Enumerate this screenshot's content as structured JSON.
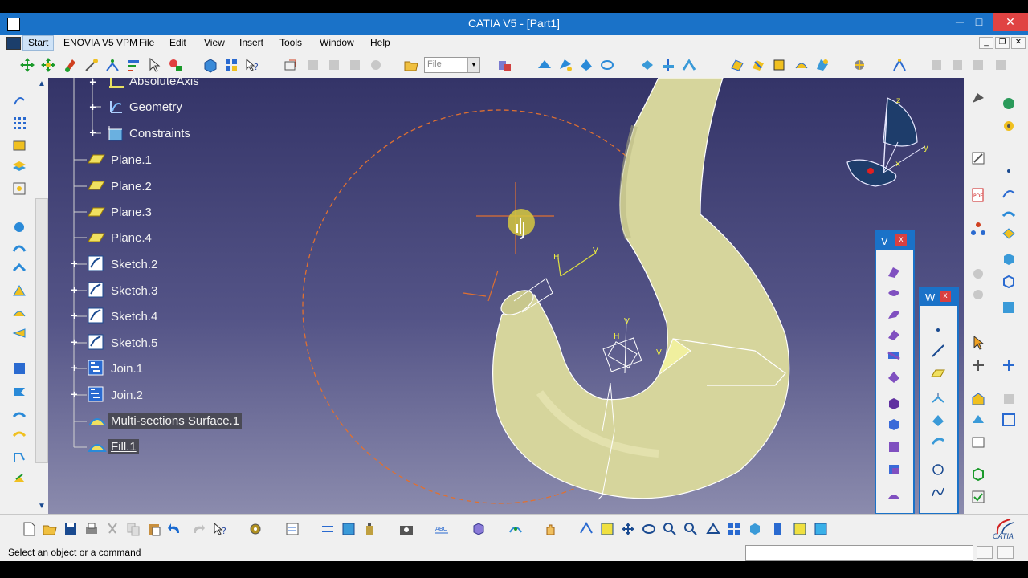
{
  "window": {
    "title": "CATIA V5 - [Part1]",
    "minimize": "─",
    "maximize": "□",
    "close": "✕"
  },
  "menubar": {
    "items": [
      "Start",
      "ENOVIA V5 VPM",
      "File",
      "Edit",
      "View",
      "Insert",
      "Tools",
      "Window",
      "Help"
    ]
  },
  "toolbar": {
    "file_select_value": "File"
  },
  "tree": {
    "nodes": [
      {
        "label": "AbsoluteAxis",
        "icon": "axis-system-icon"
      },
      {
        "label": "Geometry",
        "icon": "geometry-icon"
      },
      {
        "label": "Constraints",
        "icon": "constraints-icon"
      },
      {
        "label": "Plane.1",
        "icon": "plane-icon"
      },
      {
        "label": "Plane.2",
        "icon": "plane-icon"
      },
      {
        "label": "Plane.3",
        "icon": "plane-icon"
      },
      {
        "label": "Plane.4",
        "icon": "plane-icon"
      },
      {
        "label": "Sketch.2",
        "icon": "sketch-icon"
      },
      {
        "label": "Sketch.3",
        "icon": "sketch-icon"
      },
      {
        "label": "Sketch.4",
        "icon": "sketch-icon"
      },
      {
        "label": "Sketch.5",
        "icon": "sketch-icon"
      },
      {
        "label": "Join.1",
        "icon": "join-icon"
      },
      {
        "label": "Join.2",
        "icon": "join-icon"
      },
      {
        "label": "Multi-sections Surface.1",
        "icon": "multi-sections-surface-icon"
      },
      {
        "label": "Fill.1",
        "icon": "fill-icon"
      }
    ]
  },
  "compass": {
    "x": "x",
    "y": "y",
    "z": "z"
  },
  "viewport_labels": {
    "h1": "H",
    "v1": "V",
    "h2": "H",
    "v2": "V",
    "v3": "V"
  },
  "palettes": [
    {
      "title": "V",
      "close": "x"
    },
    {
      "title": "W",
      "close": "x"
    }
  ],
  "brand": {
    "logo_text": "CATIA"
  },
  "status": {
    "message": "Select an object or a command",
    "command_input": ""
  },
  "colors": {
    "titlebar": "#1a72c8",
    "viewport_top": "#343468",
    "viewport_bottom": "#8b8bad",
    "surface": "#d8d8a0",
    "construction": "#e07030"
  }
}
